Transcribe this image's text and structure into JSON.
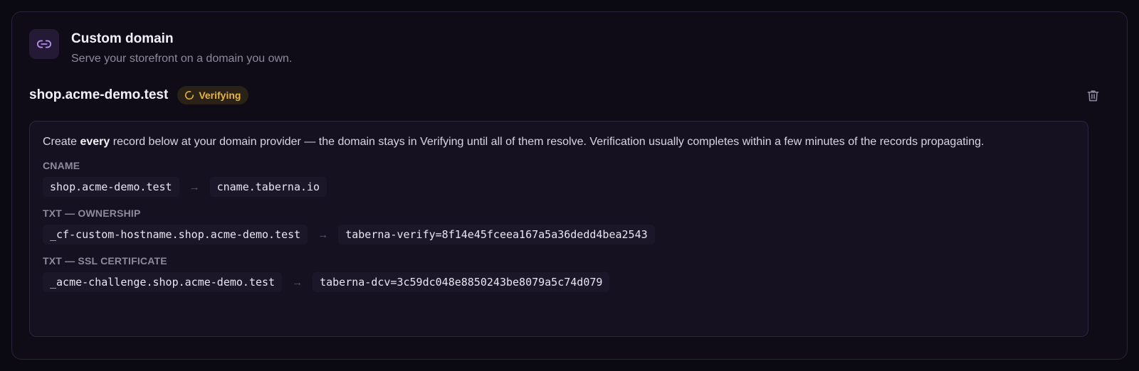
{
  "card": {
    "title": "Custom domain",
    "subtitle": "Serve your storefront on a domain you own.",
    "icon": "link-icon",
    "accent_color": "#b98cf0"
  },
  "domain": {
    "name": "shop.acme-demo.test",
    "status": "Verifying",
    "status_color": "#e7b446",
    "delete_icon": "trash-icon"
  },
  "instructions": {
    "before": "Create ",
    "emphasis": "every",
    "after": " record below at your domain provider — the domain stays in Verifying until all of them resolve. Verification usually completes within a few minutes of the records propagating."
  },
  "records": [
    {
      "label": "CNAME",
      "name": "shop.acme-demo.test",
      "arrow": "→",
      "value": "cname.taberna.io"
    },
    {
      "label": "TXT — OWNERSHIP",
      "name": "_cf-custom-hostname.shop.acme-demo.test",
      "arrow": "→",
      "value": "taberna-verify=8f14e45fceea167a5a36dedd4bea2543"
    },
    {
      "label": "TXT — SSL CERTIFICATE",
      "name": "_acme-challenge.shop.acme-demo.test",
      "arrow": "→",
      "value": "taberna-dcv=3c59dc048e8850243be8079a5c74d079"
    }
  ]
}
